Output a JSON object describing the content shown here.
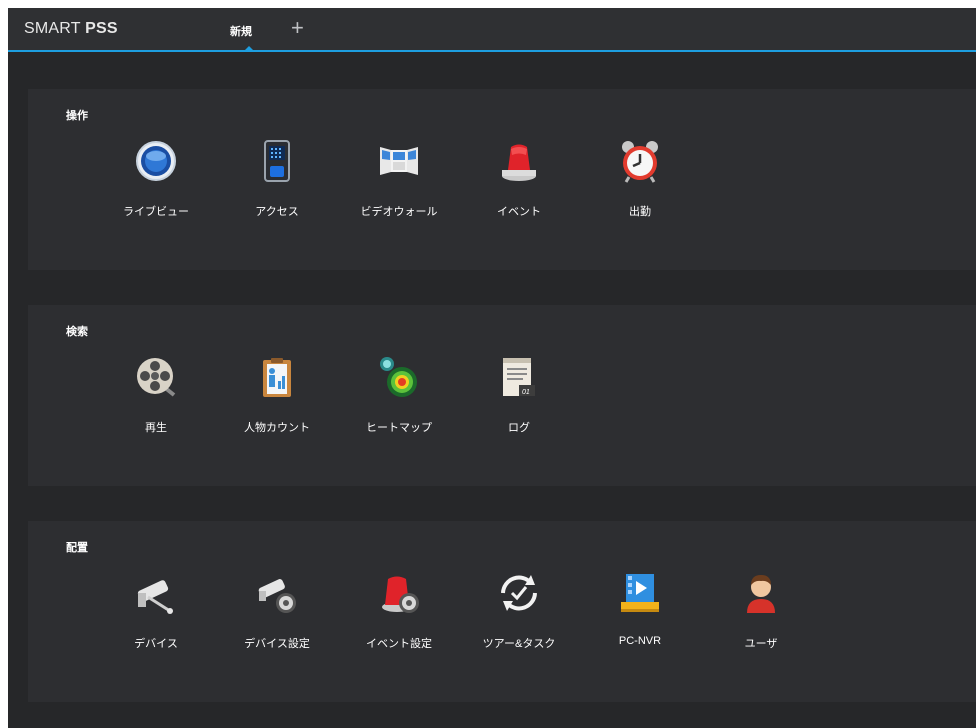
{
  "app": {
    "brand_prefix": "SMART ",
    "brand_bold": "PSS"
  },
  "tabs": [
    {
      "label": "新規",
      "active": true
    }
  ],
  "add_tab": "+",
  "colors": {
    "accent": "#1d9ee0",
    "background": "#262729",
    "panel": "#2d2e31"
  },
  "sections": [
    {
      "title": "操作",
      "items": [
        {
          "label": "ライブビュー",
          "icon": "live-view-icon"
        },
        {
          "label": "アクセス",
          "icon": "access-control-icon"
        },
        {
          "label": "ビデオウォール",
          "icon": "video-wall-icon"
        },
        {
          "label": "イベント",
          "icon": "alarm-light-icon"
        },
        {
          "label": "出勤",
          "icon": "alarm-clock-icon"
        }
      ]
    },
    {
      "title": "検索",
      "items": [
        {
          "label": "再生",
          "icon": "film-reel-icon"
        },
        {
          "label": "人物カウント",
          "icon": "people-counting-icon"
        },
        {
          "label": "ヒートマップ",
          "icon": "heat-map-icon"
        },
        {
          "label": "ログ",
          "icon": "log-notepad-icon"
        }
      ]
    },
    {
      "title": "配置",
      "items": [
        {
          "label": "デバイス",
          "icon": "camera-icon"
        },
        {
          "label": "デバイス設定",
          "icon": "camera-gear-icon"
        },
        {
          "label": "イベント設定",
          "icon": "alarm-gear-icon"
        },
        {
          "label": "ツアー&タスク",
          "icon": "clock-check-icon"
        },
        {
          "label": "PC-NVR",
          "icon": "pc-nvr-icon"
        },
        {
          "label": "ユーザ",
          "icon": "user-icon"
        }
      ]
    }
  ]
}
